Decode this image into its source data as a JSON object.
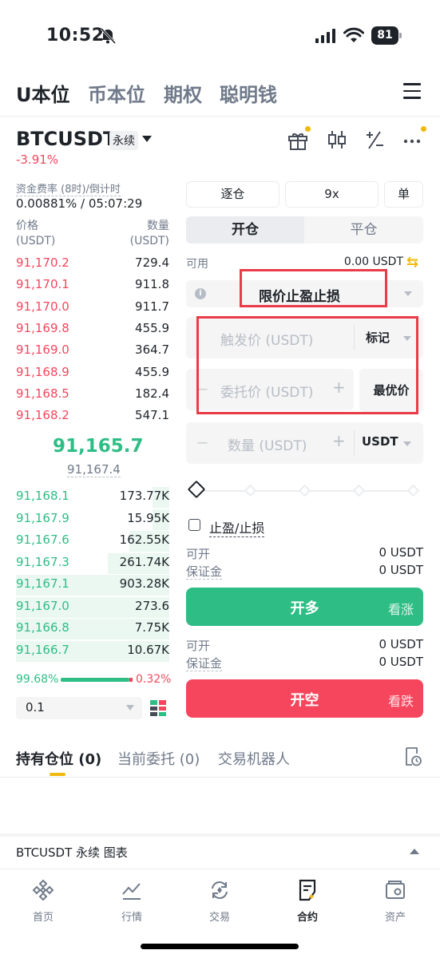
{
  "status_bar": {
    "time": "10:52",
    "battery": "81"
  },
  "top_tabs": [
    "U本位",
    "币本位",
    "期权",
    "聪明钱"
  ],
  "symbol": {
    "name": "BTCUSDT",
    "badge": "永续",
    "change": "-3.91%"
  },
  "funding": {
    "label": "资金费率 (8时)/倒计时",
    "value": "0.00881% / 05:07:29"
  },
  "orderbook": {
    "price_header": "价格",
    "price_unit": "(USDT)",
    "qty_header": "数量",
    "qty_unit": "(USDT)",
    "asks": [
      {
        "price": "91,170.2",
        "qty": "729.4"
      },
      {
        "price": "91,170.1",
        "qty": "911.8"
      },
      {
        "price": "91,170.0",
        "qty": "911.7"
      },
      {
        "price": "91,169.8",
        "qty": "455.9"
      },
      {
        "price": "91,169.0",
        "qty": "364.7"
      },
      {
        "price": "91,168.9",
        "qty": "455.9"
      },
      {
        "price": "91,168.5",
        "qty": "182.4"
      },
      {
        "price": "91,168.2",
        "qty": "547.1"
      }
    ],
    "last_price": "91,165.7",
    "mark_price": "91,167.4",
    "bids": [
      {
        "price": "91,168.1",
        "qty": "173.77K",
        "depth": 0.11
      },
      {
        "price": "91,167.9",
        "qty": "15.95K",
        "depth": 0.11
      },
      {
        "price": "91,167.6",
        "qty": "162.55K",
        "depth": 0.26
      },
      {
        "price": "91,167.3",
        "qty": "261.74K",
        "depth": 0.4
      },
      {
        "price": "91,167.1",
        "qty": "903.28K",
        "depth": 1.0
      },
      {
        "price": "91,167.0",
        "qty": "273.6",
        "depth": 1.0
      },
      {
        "price": "91,166.8",
        "qty": "7.75K",
        "depth": 1.0
      },
      {
        "price": "91,166.7",
        "qty": "10.67K",
        "depth": 1.0
      }
    ],
    "buy_ratio": "99.68%",
    "sell_ratio": "0.32%",
    "depth_step": "0.1"
  },
  "order_form": {
    "margin_mode": "逐仓",
    "leverage": "9x",
    "position_mode": "单",
    "open_tab": "开仓",
    "close_tab": "平仓",
    "available_label": "可用",
    "available_value": "0.00 USDT",
    "order_type": "限价止盈止损",
    "trigger_placeholder": "触发价 (USDT)",
    "trigger_source": "标记",
    "limit_placeholder": "委托价 (USDT)",
    "best_price": "最优价",
    "qty_placeholder": "数量 (USDT)",
    "qty_unit": "USDT",
    "tpsl_label": "止盈/止损",
    "long": {
      "open_label": "可开",
      "open_value": "0 USDT",
      "margin_label": "保证金",
      "margin_value": "0 USDT",
      "button": "开多",
      "sub": "看涨"
    },
    "short": {
      "open_label": "可开",
      "open_value": "0 USDT",
      "margin_label": "保证金",
      "margin_value": "0 USDT",
      "button": "开空",
      "sub": "看跌"
    }
  },
  "position_tabs": [
    "持有仓位 (0)",
    "当前委托 (0)",
    "交易机器人"
  ],
  "chart_bar": "BTCUSDT 永续  图表",
  "bottom_nav": [
    "首页",
    "行情",
    "交易",
    "合约",
    "资产"
  ],
  "colors": {
    "ask": "#f6465d",
    "bid": "#2ebd85",
    "brand": "#f0b90b",
    "highlight": "#ea3b49"
  }
}
